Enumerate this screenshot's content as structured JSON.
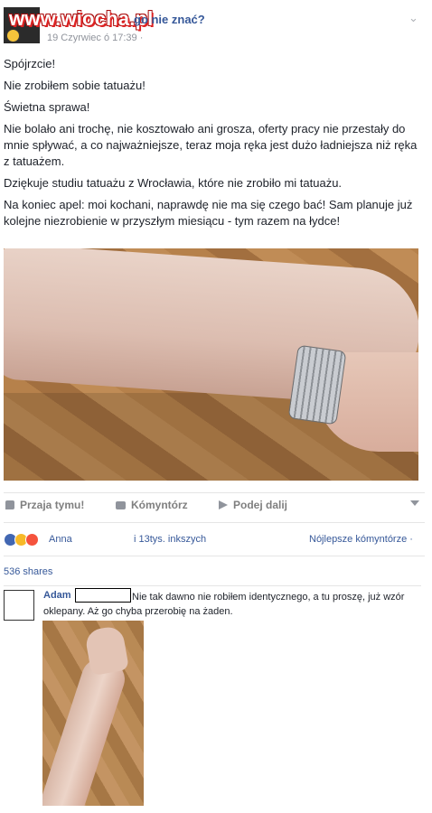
{
  "header": {
    "watermark": "www.wiocha.pl",
    "author_visible": "go nie znać?",
    "timestamp": "19 Czyrwiec ó 17:39 ·"
  },
  "post": {
    "paragraphs": [
      "Spójrzcie!",
      "Nie zrobiłem sobie tatuażu!",
      "Świetna sprawa!",
      "Nie bolało ani trochę, nie kosztowało ani grosza, oferty pracy nie przestały do mnie spływać, a co najważniejsze, teraz moja ręka jest dużo ładniejsza niż ręka z tatuażem.",
      "Dziękuje studiu tatuażu z Wrocławia, które nie zrobiło mi tatuażu.",
      "Na koniec apel: moi kochani, naprawdę nie ma się czego bać! Sam planuje już kolejne niezrobienie w przyszłym miesiącu - tym razem na łydce!"
    ]
  },
  "actions": {
    "like": "Przaja tymu!",
    "comment": "Kómyntórz",
    "share": "Podej dalij"
  },
  "reactions": {
    "names": "Anna",
    "others": "i 13tys. inkszych",
    "sort": "Nójlepsze kómyntórze ·",
    "colors": [
      "#4267b2",
      "#f7b928",
      "#f5533d"
    ]
  },
  "shares": "536 shares",
  "comment": {
    "author": "Adam",
    "text": "Nie tak dawno nie robiłem identycznego, a tu proszę, już wzór oklepany. Aż go chyba przerobię na żaden."
  }
}
